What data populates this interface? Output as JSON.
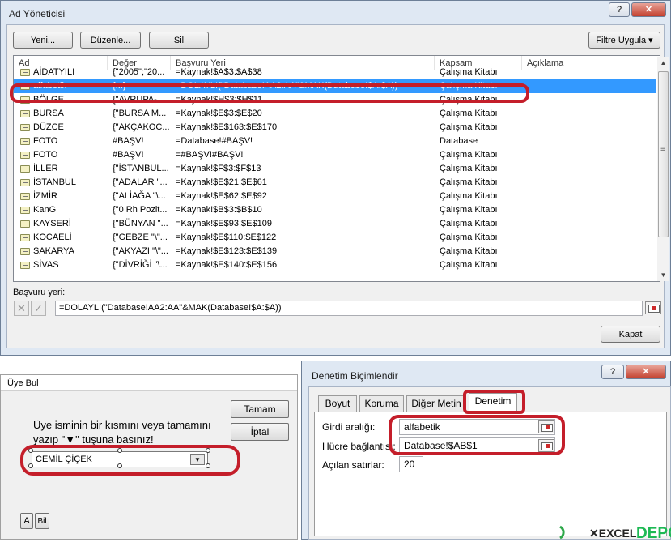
{
  "name_manager": {
    "title": "Ad Yöneticisi",
    "title_buttons": [
      "?",
      "✕"
    ],
    "buttons": {
      "new": "Yeni...",
      "edit": "Düzenle...",
      "delete": "Sil",
      "filter": "Filtre Uygula",
      "filter_arrow": "▾",
      "close": "Kapat"
    },
    "columns": [
      "Ad",
      "Değer",
      "Başvuru Yeri",
      "Kapsam",
      "Açıklama"
    ],
    "rows": [
      {
        "name": "AİDATYILI",
        "value": "{\"2005\";\"20...",
        "ref": "=Kaynak!$A$3:$A$38",
        "scope": "Çalışma Kitabı"
      },
      {
        "name": "alfabetik",
        "value": "{...}",
        "ref": "=DOLAYLI(\"Database!AA2:AA\"&MAK(Database!$A:$A))",
        "scope": "Çalışma Kitabı"
      },
      {
        "name": "BÖLGE",
        "value": "{\"AVRUPA-...",
        "ref": "=Kaynak!$H$3:$H$11",
        "scope": "Çalışma Kitabı"
      },
      {
        "name": "BURSA",
        "value": "{\"BURSA M...",
        "ref": "=Kaynak!$E$3:$E$20",
        "scope": "Çalışma Kitabı"
      },
      {
        "name": "DÜZCE",
        "value": "{\"AKÇAKOC...",
        "ref": "=Kaynak!$E$163:$E$170",
        "scope": "Çalışma Kitabı"
      },
      {
        "name": "FOTO",
        "value": "#BAŞV!",
        "ref": "=Database!#BAŞV!",
        "scope": "Database"
      },
      {
        "name": "FOTO",
        "value": "#BAŞV!",
        "ref": "=#BAŞV!#BAŞV!",
        "scope": "Çalışma Kitabı"
      },
      {
        "name": "İLLER",
        "value": "{\"İSTANBUL...",
        "ref": "=Kaynak!$F$3:$F$13",
        "scope": "Çalışma Kitabı"
      },
      {
        "name": "İSTANBUL",
        "value": "{\"ADALAR \"...",
        "ref": "=Kaynak!$E$21:$E$61",
        "scope": "Çalışma Kitabı"
      },
      {
        "name": "İZMİR",
        "value": "{\"ALİAĞA \"\\...",
        "ref": "=Kaynak!$E$62:$E$92",
        "scope": "Çalışma Kitabı"
      },
      {
        "name": "KanG",
        "value": "{\"0 Rh Pozit...",
        "ref": "=Kaynak!$B$3:$B$10",
        "scope": "Çalışma Kitabı"
      },
      {
        "name": "KAYSERİ",
        "value": "{\"BÜNYAN \"...",
        "ref": "=Kaynak!$E$93:$E$109",
        "scope": "Çalışma Kitabı"
      },
      {
        "name": "KOCAELİ",
        "value": "{\"GEBZE \"\\\"...",
        "ref": "=Kaynak!$E$110:$E$122",
        "scope": "Çalışma Kitabı"
      },
      {
        "name": "SAKARYA",
        "value": "{\"AKYAZI \"\\\"...",
        "ref": "=Kaynak!$E$123:$E$139",
        "scope": "Çalışma Kitabı"
      },
      {
        "name": "SİVAS",
        "value": "{\"DİVRİĞİ \"\\...",
        "ref": "=Kaynak!$E$140:$E$156",
        "scope": "Çalışma Kitabı"
      }
    ],
    "selected_row": 1,
    "ref_label": "Başvuru yeri:",
    "ref_value": "=DOLAYLI(\"Database!AA2:AA\"&MAK(Database!$A:$A))",
    "scroll_up": "▲",
    "scroll_down": "▼",
    "scroll_grip": "≡"
  },
  "member_find": {
    "title": "Üye Bul",
    "ok": "Tamam",
    "cancel": "İptal",
    "instruction_line1": "Üye isminin bir kısmını veya tamamını",
    "instruction_line2": "yazıp \"▼\" tuşuna basınız!",
    "combo_value": "CEMİL ÇİÇEK",
    "combo_arrow": "▼",
    "small_buttons": [
      "A",
      "Bil"
    ]
  },
  "format_control": {
    "title": "Denetim Biçimlendir",
    "title_buttons": [
      "?",
      "✕"
    ],
    "tabs": [
      "Boyut",
      "Koruma",
      "Diğer Metin",
      "Denetim"
    ],
    "active_tab": 3,
    "input_range_label": "Girdi aralığı:",
    "input_range_value": "alfabetik",
    "cell_link_label": "Hücre bağlantısı:",
    "cell_link_value": "Database!$AB$1",
    "dropdown_lines_label": "Açılan satırlar:",
    "dropdown_lines_value": "20"
  },
  "colors": {
    "highlight": "#3399ff",
    "annotation": "#c41e2a",
    "titlebar": "#dfe8f3"
  }
}
